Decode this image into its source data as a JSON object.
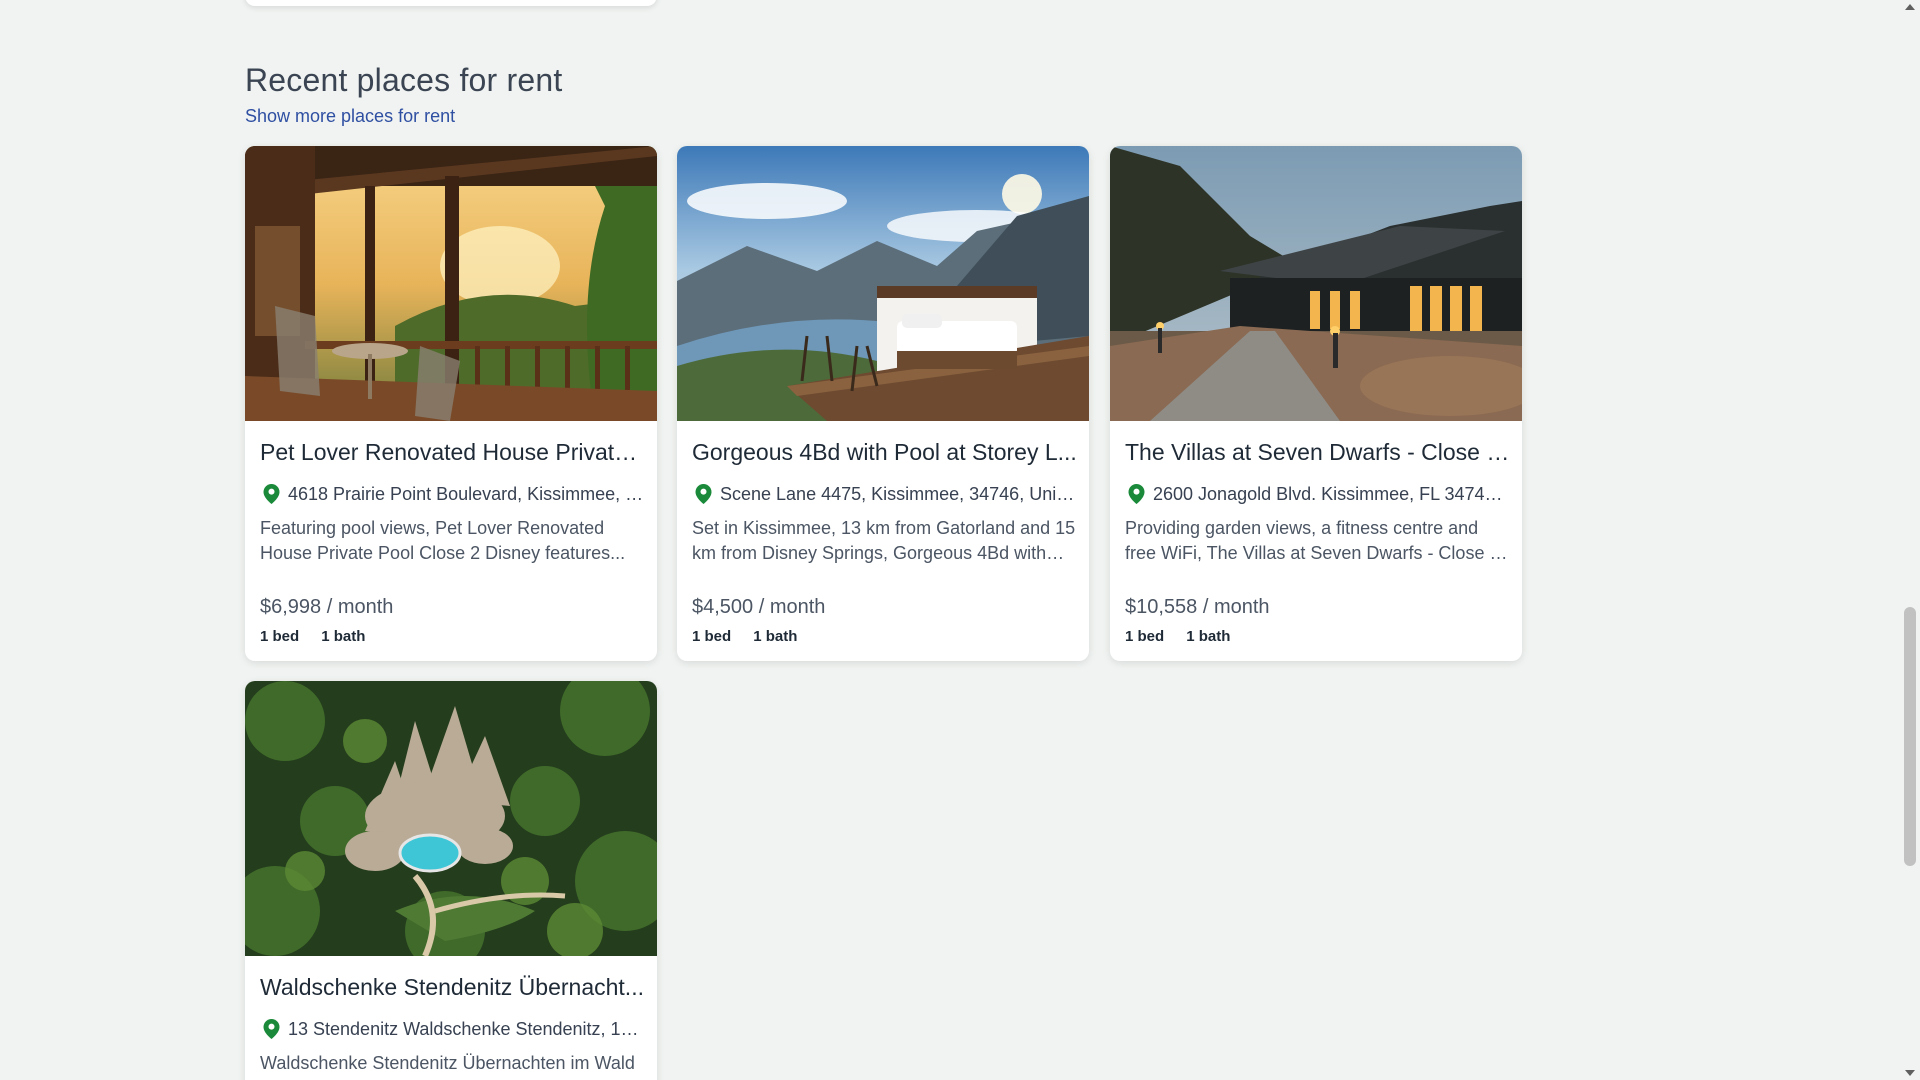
{
  "section": {
    "title": "Recent places for rent",
    "link_label": "Show more places for rent"
  },
  "listings": [
    {
      "title": "Pet Lover Renovated House Private ...",
      "address": "4618 Prairie Point Boulevard, Kissimmee, FL ...",
      "description": "Featuring pool views, Pet Lover Renovated House Private Pool Close 2 Disney features...",
      "price": "$6,998 / month",
      "beds": "1 bed",
      "baths": "1 bath"
    },
    {
      "title": "Gorgeous 4Bd with Pool at Storey L...",
      "address": "Scene Lane 4475, Kissimmee, 34746, United ...",
      "description": "Set in Kissimmee, 13 km from Gatorland and 15 km from Disney Springs, Gorgeous 4Bd with Po...",
      "price": "$4,500 / month",
      "beds": "1 bed",
      "baths": "1 bath"
    },
    {
      "title": "The Villas at Seven Dwarfs - Close t...",
      "address": "2600 Jonagold Blvd. Kissimmee, FL 34746, Ki...",
      "description": "Providing garden views, a fitness centre and free WiFi, The Villas at Seven Dwarfs - Close to Disn...",
      "price": "$10,558 / month",
      "beds": "1 bed",
      "baths": "1 bath"
    },
    {
      "title": "Waldschenke Stendenitz Übernacht...",
      "address": "13 Stendenitz Waldschenke Stendenitz, 1682...",
      "description": "Waldschenke Stendenitz Übernachten im Wald"
    }
  ],
  "colors": {
    "page_background": "#f0f3f1",
    "link": "#2f4fa2",
    "pin": "#1a8a3a"
  },
  "icons": {
    "location": "map-pin-icon"
  }
}
